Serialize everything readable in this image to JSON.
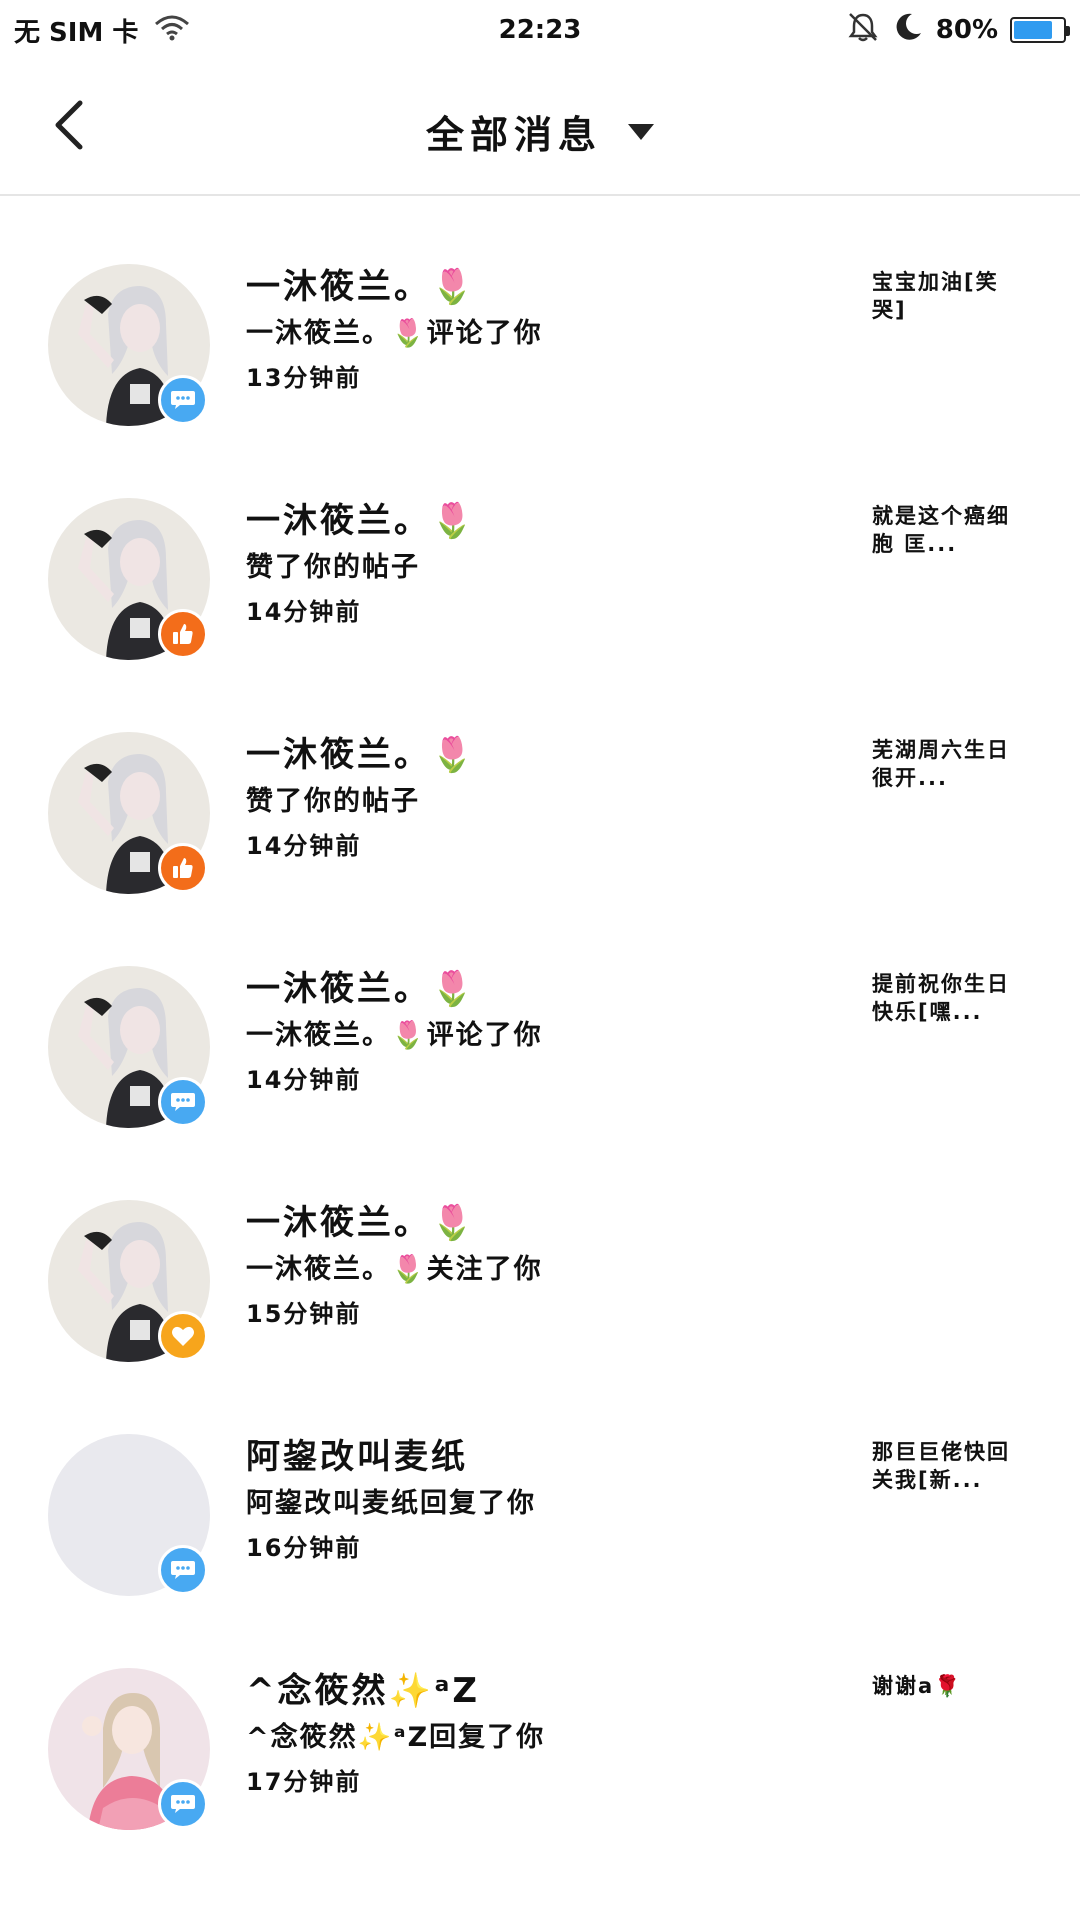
{
  "status_bar": {
    "carrier": "无 SIM 卡",
    "time": "22:23",
    "battery_text": "80%",
    "battery_level": 0.8,
    "icons": [
      "wifi-icon",
      "bell-muted-icon",
      "moon-icon",
      "battery-icon"
    ]
  },
  "header": {
    "title": "全部消息",
    "back_icon": "chevron-left-icon",
    "dropdown_icon": "caret-down-icon"
  },
  "messages": [
    {
      "name": "一沐筱兰。🌷",
      "action": "一沐筱兰。🌷评论了你",
      "time": "13分钟前",
      "preview": "宝宝加油[笑哭]",
      "type": "comment",
      "badge_icon": "comment-bubble-icon"
    },
    {
      "name": "一沐筱兰。🌷",
      "action": "赞了你的帖子",
      "time": "14分钟前",
      "preview": "就是这个癌细胞   匡...",
      "type": "like",
      "badge_icon": "thumbs-up-icon"
    },
    {
      "name": "一沐筱兰。🌷",
      "action": "赞了你的帖子",
      "time": "14分钟前",
      "preview": "芜湖周六生日很开...",
      "type": "like",
      "badge_icon": "thumbs-up-icon"
    },
    {
      "name": "一沐筱兰。🌷",
      "action": "一沐筱兰。🌷评论了你",
      "time": "14分钟前",
      "preview": "提前祝你生日快乐[嘿...",
      "type": "comment",
      "badge_icon": "comment-bubble-icon"
    },
    {
      "name": "一沐筱兰。🌷",
      "action": "一沐筱兰。🌷关注了你",
      "time": "15分钟前",
      "preview": "",
      "type": "follow",
      "badge_icon": "heart-icon"
    },
    {
      "name": "阿鋆改叫麦纸",
      "action": "阿鋆改叫麦纸回复了你",
      "time": "16分钟前",
      "preview": "那巨巨佬快回关我[新...",
      "type": "comment",
      "badge_icon": "comment-bubble-icon"
    },
    {
      "name": "^念筱然✨ᵃZ",
      "action": "^念筱然✨ᵃZ回复了你",
      "time": "17分钟前",
      "preview": "谢谢a🌹",
      "type": "comment",
      "badge_icon": "comment-bubble-icon"
    }
  ],
  "colors": {
    "comment_badge": "#48a9f2",
    "like_badge": "#f36d1a",
    "follow_badge": "#f7a51c",
    "battery_fill": "#2f9bf0"
  }
}
